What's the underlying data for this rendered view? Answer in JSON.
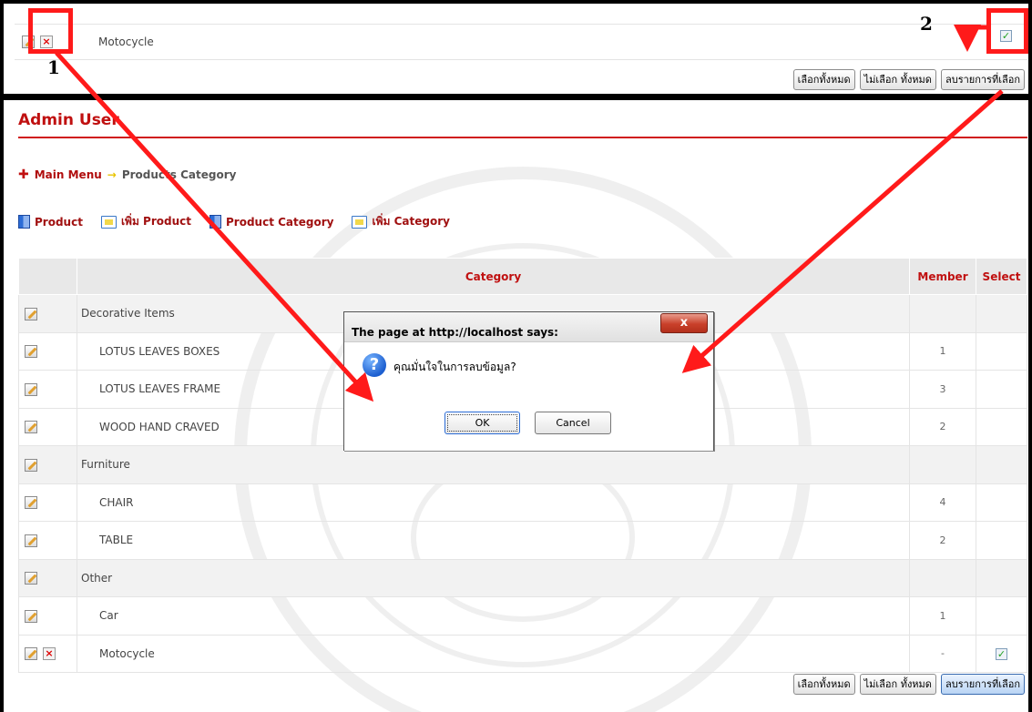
{
  "top_excerpt": {
    "row_label": "Motocycle",
    "member": "-",
    "buttons": [
      "เลือกทั้งหมด",
      "ไม่เลือก ทั้งหมด",
      "ลบรายการที่เลือก"
    ]
  },
  "annotations": {
    "step1": "1",
    "step2": "2"
  },
  "page": {
    "title": "Admin User",
    "breadcrumb": {
      "home": "Main Menu",
      "current": "Products Category"
    },
    "toolbar": {
      "product": "Product",
      "add_product": "เพิ่ม Product",
      "product_category": "Product Category",
      "add_category": "เพิ่ม Category"
    }
  },
  "table": {
    "headers": {
      "category": "Category",
      "member": "Member",
      "select": "Select"
    },
    "rows": [
      {
        "name": "Decorative Items",
        "member": "",
        "group": true
      },
      {
        "name": "LOTUS LEAVES BOXES",
        "member": "1",
        "group": false
      },
      {
        "name": "LOTUS LEAVES FRAME",
        "member": "3",
        "group": false
      },
      {
        "name": "WOOD HAND CRAVED",
        "member": "2",
        "group": false
      },
      {
        "name": "Furniture",
        "member": "",
        "group": true
      },
      {
        "name": "CHAIR",
        "member": "4",
        "group": false
      },
      {
        "name": "TABLE",
        "member": "2",
        "group": false
      },
      {
        "name": "Other",
        "member": "",
        "group": true
      },
      {
        "name": "Car",
        "member": "1",
        "group": false
      },
      {
        "name": "Motocycle",
        "member": "-",
        "group": false,
        "deletable": true,
        "checked": true
      }
    ]
  },
  "bottom_buttons": [
    "เลือกทั้งหมด",
    "ไม่เลือก ทั้งหมด",
    "ลบรายการที่เลือก"
  ],
  "dialog": {
    "title": "The page at http://localhost says:",
    "close": "x",
    "message": "คุณมั่นใจในการลบข้อมูล?",
    "ok": "OK",
    "cancel": "Cancel"
  },
  "colors": {
    "accent": "#c01010",
    "annotation": "#ff1a1a",
    "header_bg": "#e8e8e8"
  }
}
